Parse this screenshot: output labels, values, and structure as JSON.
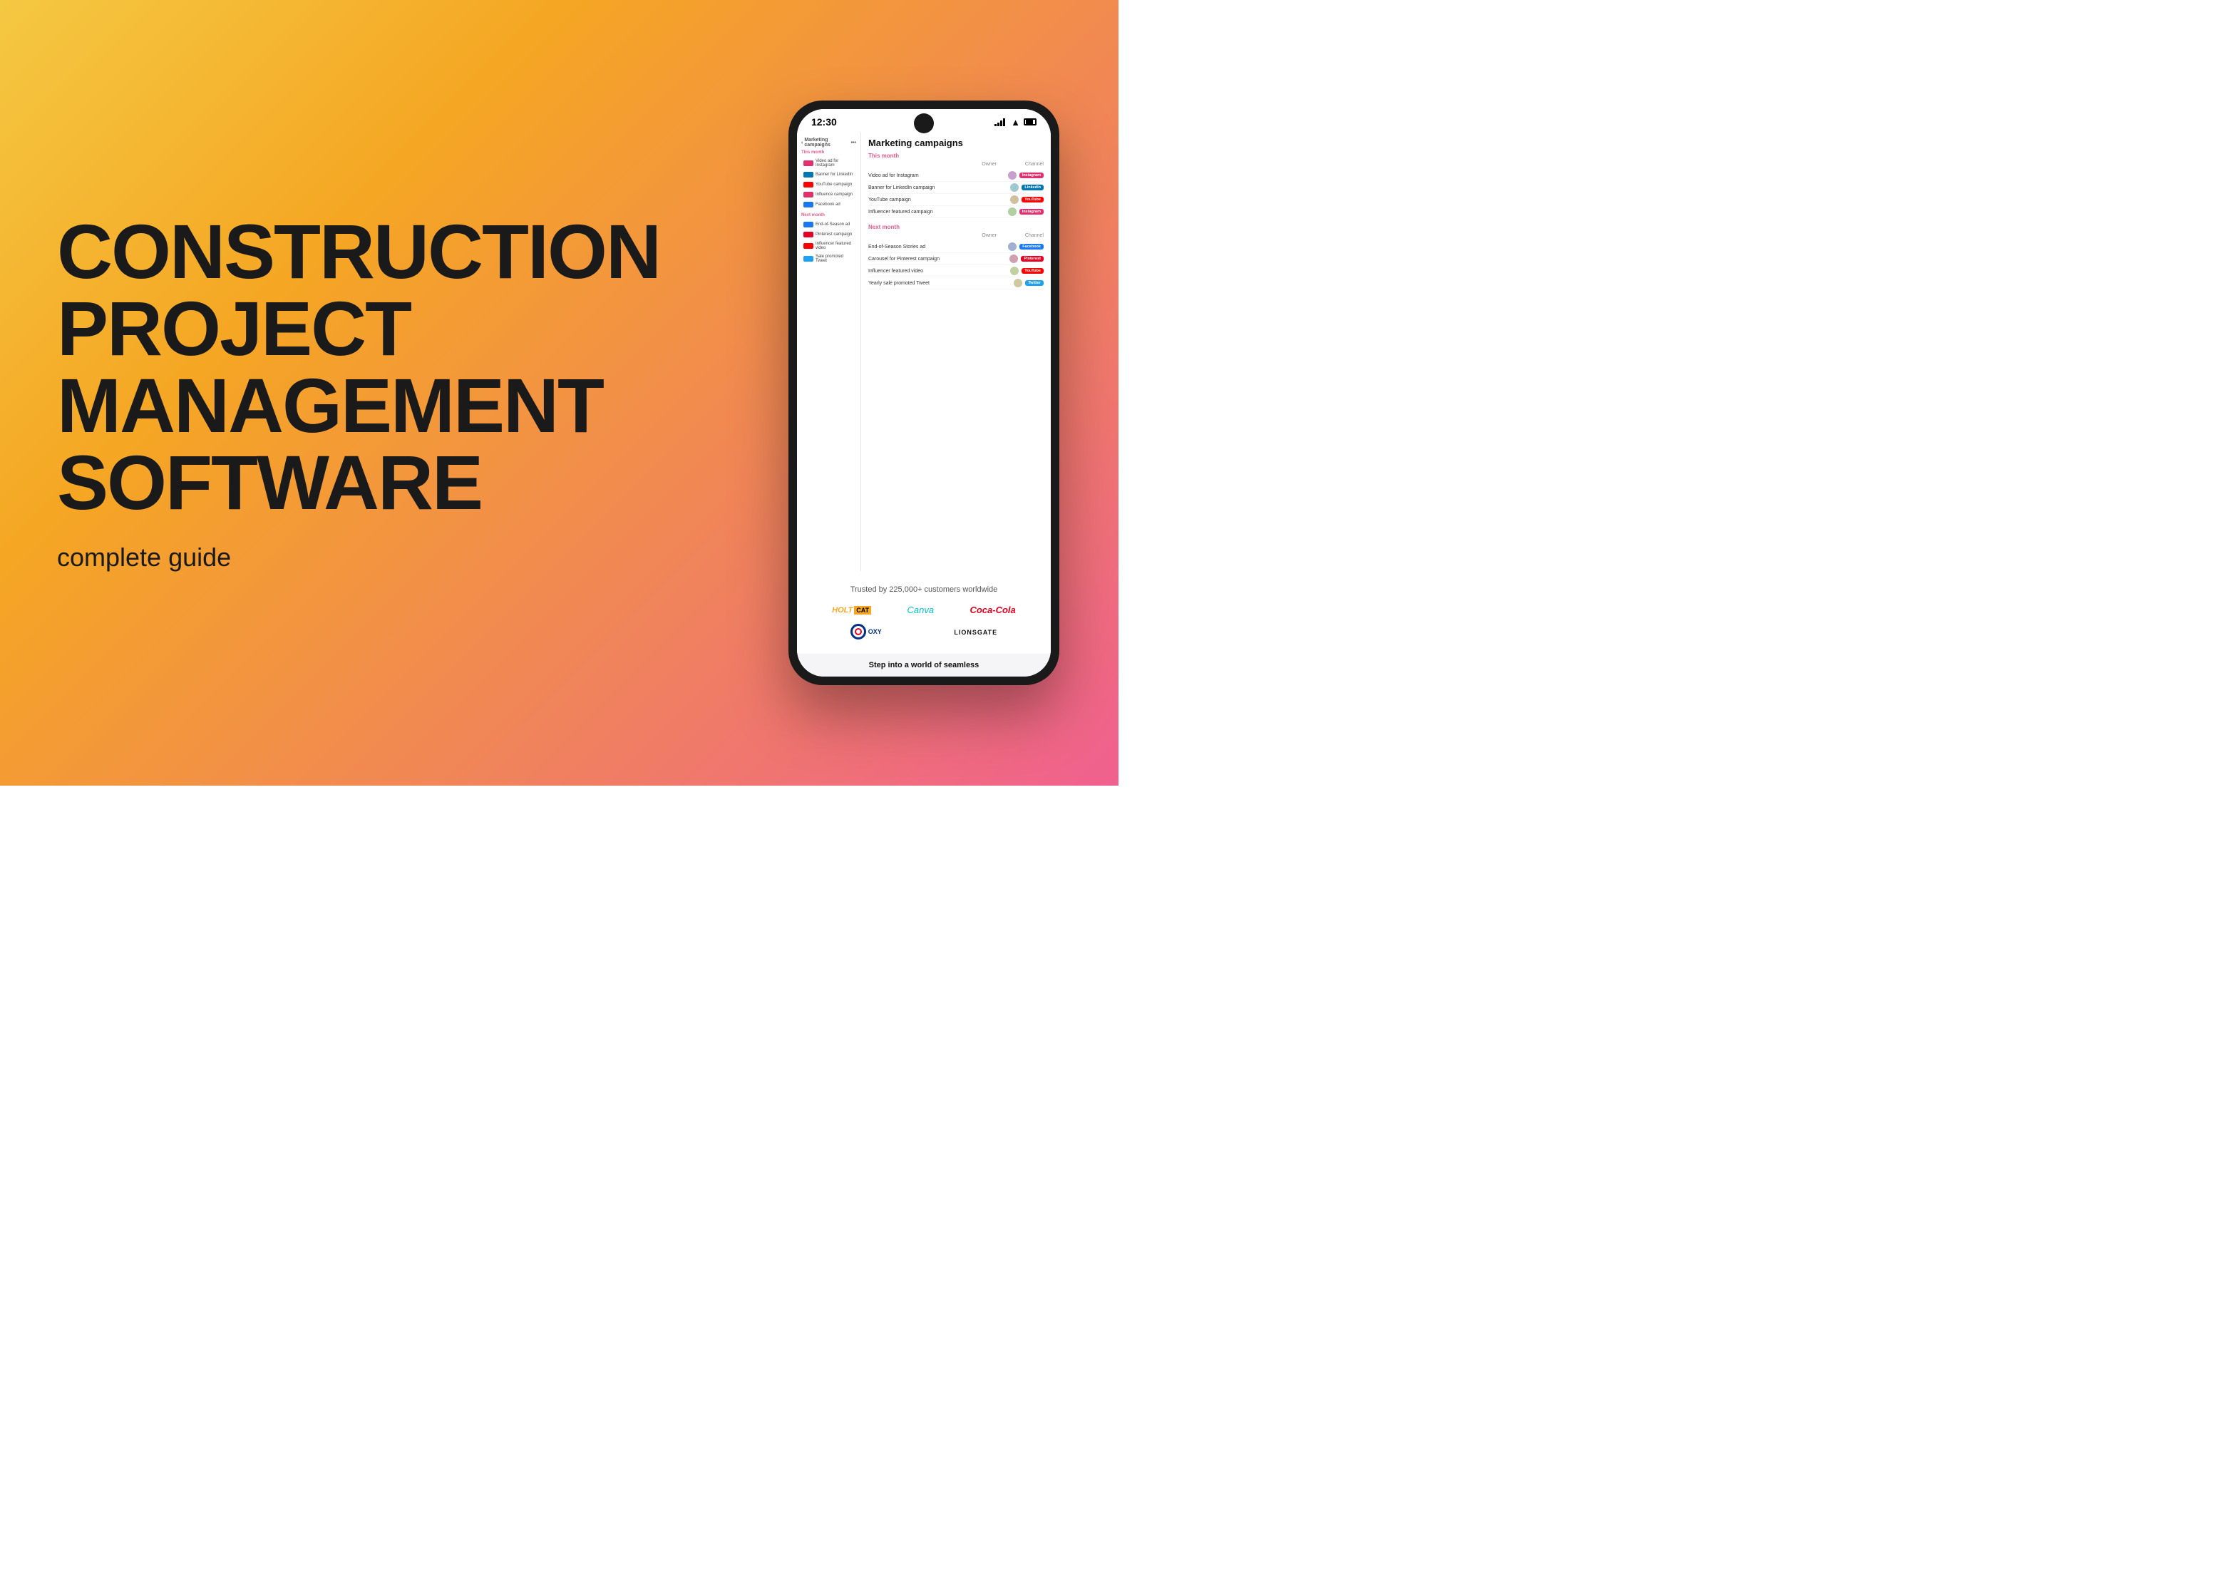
{
  "page": {
    "background": "gradient yellow to pink"
  },
  "left": {
    "title_line1": "CONSTRUCTION",
    "title_line2": "PROJECT",
    "title_line3": "MANAGEMENT",
    "title_line4": "SOFTWARE",
    "subtitle": "complete guide"
  },
  "phone": {
    "status_time": "12:30",
    "app_header": "Marketing campaigns",
    "detail_title": "Marketing campaigns",
    "this_month_label": "This month",
    "next_month_label": "Next month",
    "owner_col": "Owner",
    "channel_col": "Channel",
    "this_month_items": [
      {
        "name": "Video ad for Instagram",
        "tag": "Instagram",
        "tag_class": "tag-instagram"
      },
      {
        "name": "Banner for LinkedIn campaign",
        "tag": "LinkedIn",
        "tag_class": "tag-linkedin"
      },
      {
        "name": "YouTube campaign",
        "tag": "YouTube",
        "tag_class": "tag-youtube"
      },
      {
        "name": "Influencer featured campaign",
        "tag": "Instagram",
        "tag_class": "tag-instagram"
      }
    ],
    "next_month_items": [
      {
        "name": "End-of-Season Stories ad",
        "tag": "Facebook",
        "tag_class": "tag-facebook"
      },
      {
        "name": "Carousel for Pinterest campaign",
        "tag": "Pinterest",
        "tag_class": "tag-pinterest"
      },
      {
        "name": "Influencer featured video",
        "tag": "YouTube",
        "tag_class": "tag-youtube"
      },
      {
        "name": "Yearly sale promoted Tweet",
        "tag": "Twitter",
        "tag_class": "tag-twitter"
      }
    ],
    "trust_title": "Trusted by 225,000+ customers worldwide",
    "logos": {
      "holt": "HOLT",
      "cat": "CAT",
      "canva": "Canva",
      "coca_cola": "Coca-Cola",
      "oxy": "OXY",
      "lionsgate": "LIONSGATE"
    },
    "bottom_cta": "Step into a world of seamless"
  }
}
